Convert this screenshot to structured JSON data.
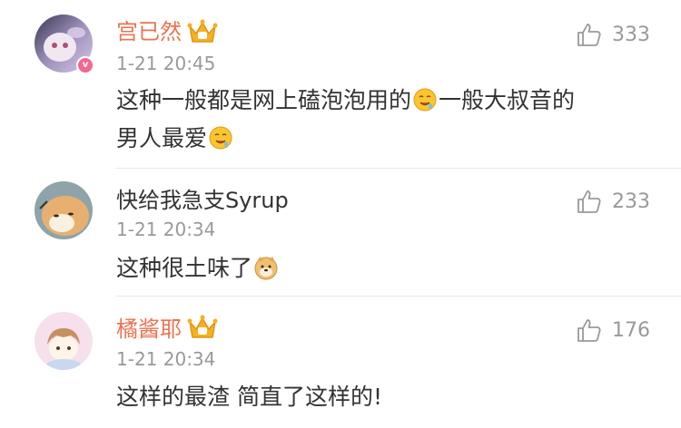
{
  "comments": [
    {
      "username": "宫已然",
      "time": "1-21 20:45",
      "likes": "333",
      "text_line1_a": "这种一般都是网上磕泡泡用的",
      "text_line1_b": "一般大叔音的",
      "text_line2_a": "男人最爱",
      "emoji": "drooling-face-emoji",
      "badge_icon": "vip-crown-icon",
      "verified_badge": "v",
      "verified_color": "#f4678f"
    },
    {
      "username": "快给我急支Syrup",
      "time": "1-21 20:34",
      "likes": "233",
      "text": "这种很土味了",
      "emoji": "doge-emoji"
    },
    {
      "username": "橘酱耶",
      "time": "1-21 20:34",
      "likes": "176",
      "text": "这样的最渣 简直了这样的!",
      "badge_icon": "vip-crown-icon"
    }
  ],
  "colors": {
    "vip_name": "#eb7350",
    "meta_text": "#999999",
    "body_text": "#333333",
    "divider": "#e8e8e8",
    "crown_gold": "#f5b21c"
  },
  "icons": {
    "like": "thumbs-up-icon"
  }
}
